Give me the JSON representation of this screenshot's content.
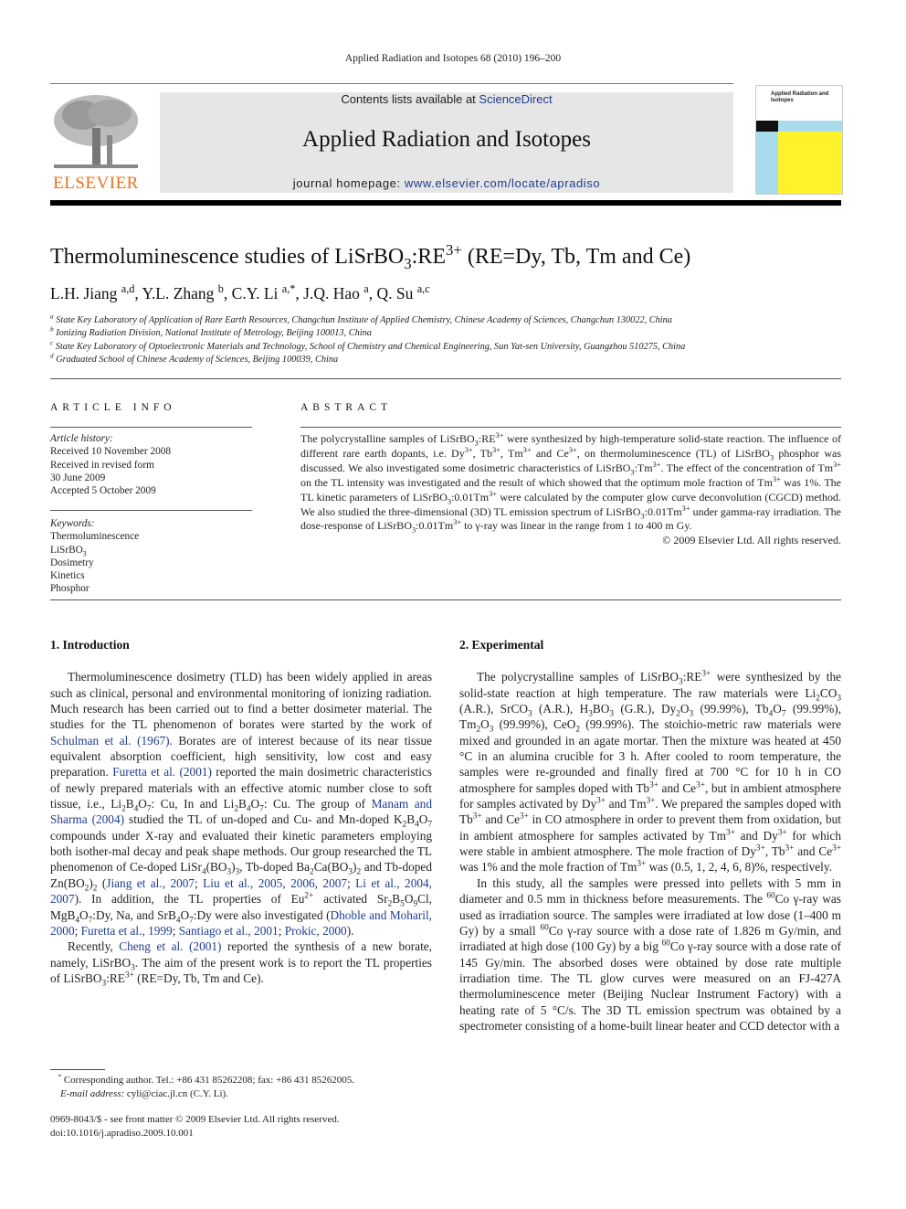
{
  "header": {
    "running_head": "Applied Radiation and Isotopes 68 (2010) 196–200",
    "publisher_logo": "ELSEVIER",
    "contents_prefix": "Contents lists available at ",
    "contents_link": "ScienceDirect",
    "journal_title": "Applied Radiation and Isotopes",
    "homepage_prefix": "journal homepage: ",
    "homepage_link": "www.elsevier.com/locate/apradiso",
    "cover_title": "Applied Radiation and Isotopes",
    "colors": {
      "publisher_orange": "#e9711c",
      "link_blue": "#1f3b8f",
      "banner_gray": "#e6e6e6",
      "cover_blue": "#a8dcec",
      "cover_yellow": "#fff22a"
    }
  },
  "article": {
    "title_main": "Thermoluminescence studies of LiSrBO",
    "title_sub": "3",
    "title_mid": ":RE",
    "title_sup": "3+",
    "title_end": " (RE=Dy, Tb, Tm and Ce)",
    "authors": [
      {
        "name": "L.H. Jiang",
        "aff": "a,d"
      },
      {
        "name": "Y.L. Zhang",
        "aff": "b"
      },
      {
        "name": "C.Y. Li",
        "aff": "a,*"
      },
      {
        "name": "J.Q. Hao",
        "aff": "a"
      },
      {
        "name": "Q. Su",
        "aff": "a,c"
      }
    ],
    "affiliations": [
      {
        "key": "a",
        "text": "State Key Laboratory of Application of Rare Earth Resources, Changchun Institute of Applied Chemistry, Chinese Academy of Sciences, Changchun 130022, China"
      },
      {
        "key": "b",
        "text": "Ionizing Radiation Division, National Institute of Metrology, Beijing 100013, China"
      },
      {
        "key": "c",
        "text": "State Key Laboratory of Optoelectronic Materials and Technology, School of Chemistry and Chemical Engineering, Sun Yat-sen University, Guangzhou 510275, China"
      },
      {
        "key": "d",
        "text": "Graduated School of Chinese Academy of Sciences, Beijing 100039, China"
      }
    ]
  },
  "article_info": {
    "heading": "ARTICLE INFO",
    "history_label": "Article history:",
    "history": [
      "Received 10 November 2008",
      "Received in revised form",
      "30 June 2009",
      "Accepted 5 October 2009"
    ],
    "keywords_label": "Keywords:",
    "keywords": [
      "Thermoluminescence",
      "LiSrBO3",
      "Dosimetry",
      "Kinetics",
      "Phosphor"
    ]
  },
  "abstract": {
    "heading": "ABSTRACT",
    "text": "The polycrystalline samples of LiSrBO3:RE3+ were synthesized by high-temperature solid-state reaction. The influence of different rare earth dopants, i.e. Dy3+, Tb3+, Tm3+ and Ce3+, on thermoluminescence (TL) of LiSrBO3 phosphor was discussed. We also investigated some dosimetric characteristics of LiSrBO3:Tm3+. The effect of the concentration of Tm3+ on the TL intensity was investigated and the result of which showed that the optimum mole fraction of Tm3+ was 1%. The TL kinetic parameters of LiSrBO3:0.01Tm3+ were calculated by the computer glow curve deconvolution (CGCD) method. We also studied the three-dimensional (3D) TL emission spectrum of LiSrBO3:0.01Tm3+ under gamma-ray irradiation. The dose-response of LiSrBO3:0.01Tm3+ to γ-ray was linear in the range from 1 to 400 m Gy.",
    "copyright": "© 2009 Elsevier Ltd. All rights reserved."
  },
  "sections": {
    "intro_heading": "1.  Introduction",
    "exp_heading": "2.  Experimental",
    "citations": {
      "schulman": "Schulman et al. (1967)",
      "furetta2001": "Furetta et al. (2001)",
      "manam": "Manam and Sharma (2004)",
      "jiang": "Jiang et al., 2007",
      "liu": "Liu et al., 2005, 2006, 2007",
      "li": "Li et al., 2004, 2007",
      "dhoble": "Dhoble and Moharil, 2000",
      "furetta1999": "Furetta et al., 1999",
      "santiago": "Santiago et al., 2001",
      "prokic": "Prokic, 2000",
      "cheng": "Cheng et al. (2001)"
    }
  },
  "footnote": {
    "marker": "*",
    "corresponding": "Corresponding author. Tel.: +86 431 85262208; fax: +86 431 85262005.",
    "email_label": "E-mail address:",
    "email": "cyli@ciac.jl.cn (C.Y. Li).",
    "issn": "0969-8043/$ - see front matter © 2009 Elsevier Ltd. All rights reserved.",
    "doi": "doi:10.1016/j.apradiso.2009.10.001"
  }
}
